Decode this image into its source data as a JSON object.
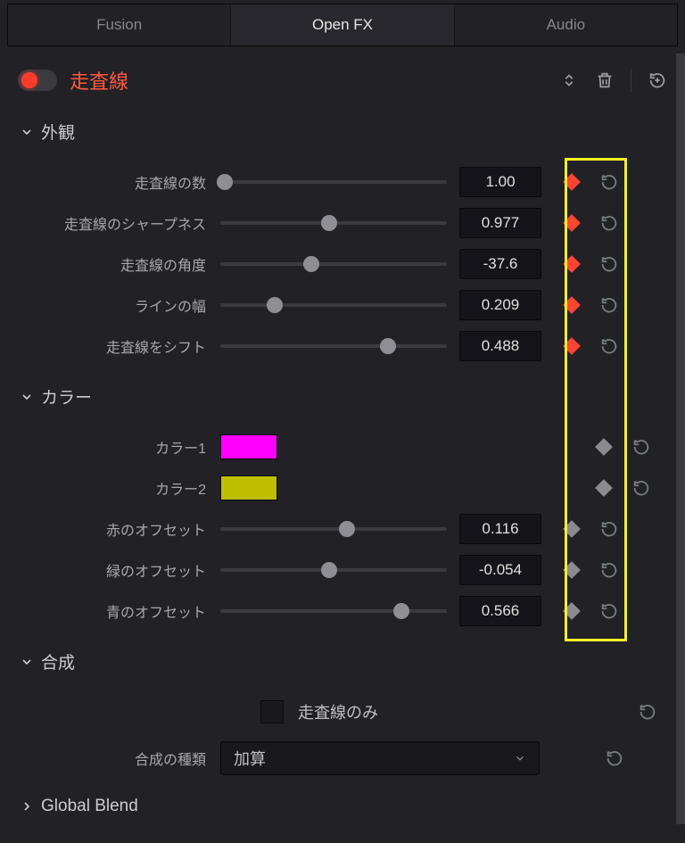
{
  "tabs": {
    "fusion": "Fusion",
    "openfx": "Open FX",
    "audio": "Audio"
  },
  "fx_name": "走査線",
  "sections": {
    "appearance": {
      "title": "外観",
      "params": [
        {
          "label": "走査線の数",
          "value": "1.00",
          "pos": 2,
          "kf": true
        },
        {
          "label": "走査線のシャープネス",
          "value": "0.977",
          "pos": 48,
          "kf": true
        },
        {
          "label": "走査線の角度",
          "value": "-37.6",
          "pos": 40,
          "kf": true
        },
        {
          "label": "ラインの幅",
          "value": "0.209",
          "pos": 24,
          "kf": true
        },
        {
          "label": "走査線をシフト",
          "value": "0.488",
          "pos": 74,
          "kf": true
        }
      ]
    },
    "color": {
      "title": "カラー",
      "params": [
        {
          "label": "カラー1",
          "type": "color",
          "color": "#ff00ff",
          "kf": false
        },
        {
          "label": "カラー2",
          "type": "color",
          "color": "#bfbf00",
          "kf": false
        },
        {
          "label": "赤のオフセット",
          "value": "0.116",
          "pos": 56,
          "kf": false
        },
        {
          "label": "緑のオフセット",
          "value": "-0.054",
          "pos": 48,
          "kf": false
        },
        {
          "label": "青のオフセット",
          "value": "0.566",
          "pos": 80,
          "kf": false
        }
      ]
    },
    "composite": {
      "title": "合成",
      "check_label": "走査線のみ",
      "type_label": "合成の種類",
      "type_value": "加算"
    },
    "global": {
      "title": "Global Blend"
    }
  }
}
